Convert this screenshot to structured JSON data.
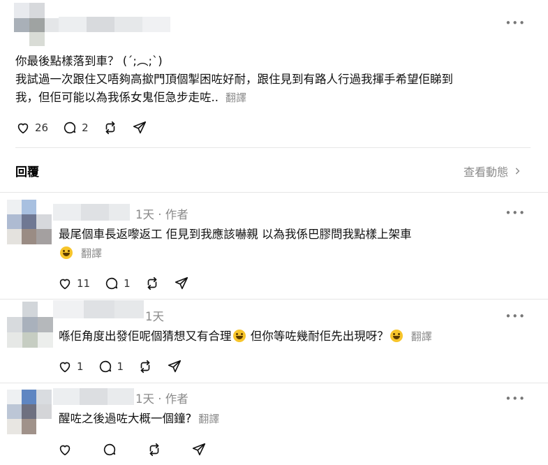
{
  "post": {
    "text_line1": "你最後點樣落到車？ (´;︵;`)",
    "text_line2": "我試過一次跟住又唔夠高撳門頂個掣困咗好耐，跟住見到有路人行過我揮手希望佢睇到",
    "text_line3": "我，但佢可能以為我係女鬼佢急步走咗..",
    "translate": "翻譯",
    "likes": "26",
    "comments": "2"
  },
  "replies_header": {
    "title": "回覆",
    "view_activity": "查看動態"
  },
  "replies": [
    {
      "meta": "1天 · 作者",
      "text_line1": "最尾個車長返嚟返工 佢見到我應該嚇親 以為我係巴膠問我點樣上架車",
      "translate": "翻譯",
      "likes": "11",
      "comments": "1"
    },
    {
      "meta": "1天",
      "text_before": "喺佢角度出發佢呢個猜想又有合理",
      "text_after": "但你等咗幾耐佢先出現呀？",
      "translate": "翻譯",
      "likes": "1",
      "comments": "1"
    },
    {
      "meta": "1天 · 作者",
      "text": "醒咗之後過咗大概一個鐘?",
      "translate": "翻譯"
    }
  ],
  "icons": {
    "heart": "heart-icon",
    "comment": "comment-icon",
    "repost": "repost-icon",
    "share": "share-icon",
    "more": "more-icon",
    "chevron": "chevron-right-icon",
    "emoji": "grinning-sweat-emoji"
  }
}
